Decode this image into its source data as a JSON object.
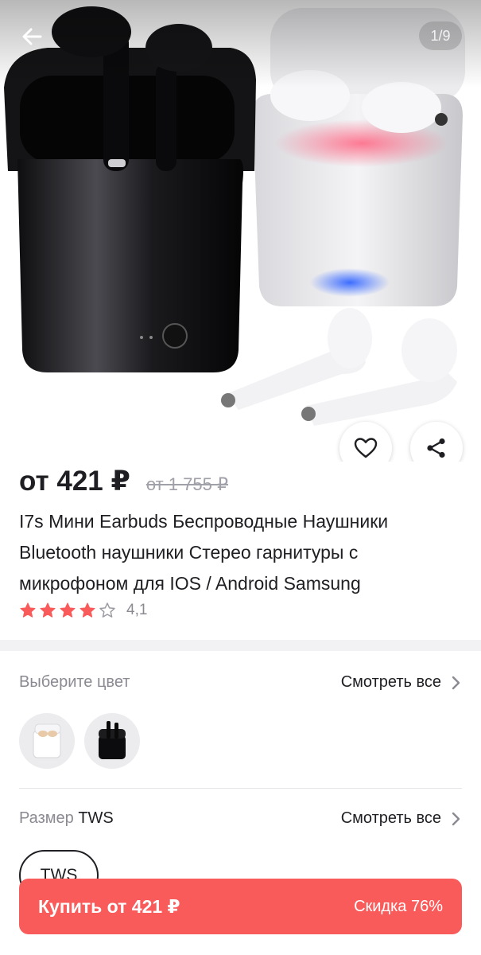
{
  "gallery": {
    "counter": "1/9",
    "image_alt": "product-photo"
  },
  "product": {
    "price": "от 421 ₽",
    "old_price": "от 1 755 ₽",
    "title": "I7s Мини Earbuds Беспроводные Наушники Bluetooth наушники Стерео гарнитуры с микрофоном для IOS / Android Samsung",
    "rating": 4.1,
    "rating_text": "4,1",
    "stars_total": 5
  },
  "color_section": {
    "label": "Выберите цвет",
    "see_all": "Смотреть все",
    "options": [
      "white",
      "black"
    ]
  },
  "size_section": {
    "label": "Размер",
    "selected_value": "TWS",
    "see_all": "Смотреть все",
    "chip": "TWS"
  },
  "buy": {
    "label": "Купить от 421 ₽",
    "discount": "Скидка 76%"
  },
  "colors": {
    "accent": "#f95b5b",
    "star": "#f95b5b",
    "text_primary": "#1f1f23",
    "text_secondary": "#8a8a92"
  },
  "icons": {
    "back": "arrow-left-icon",
    "favorite": "heart-icon",
    "share": "share-icon",
    "chevron": "chevron-right-icon",
    "star": "star-icon"
  }
}
